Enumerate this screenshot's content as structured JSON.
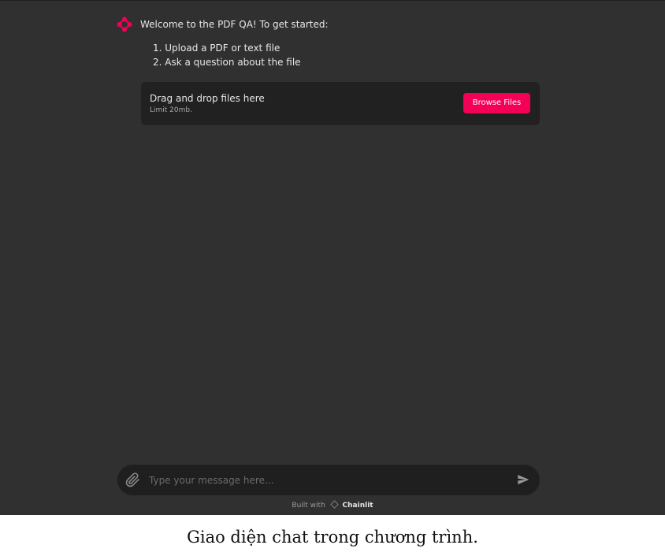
{
  "message": {
    "welcome": "Welcome to the PDF QA! To get started:",
    "steps": [
      "1. Upload a PDF or text file",
      "2. Ask a question about the file"
    ]
  },
  "upload": {
    "title": "Drag and drop files here",
    "limit": "Limit 20mb.",
    "button_label": "Browse Files"
  },
  "composer": {
    "placeholder": "Type your message here..."
  },
  "footer": {
    "built_with": "Built with",
    "brand": "Chainlit"
  },
  "caption": "Giao diện chat trong chương trình.",
  "colors": {
    "background": "#303030",
    "panel": "#212121",
    "accent": "#f50057"
  },
  "icons": {
    "avatar": "chainlit-logo-icon",
    "attach": "paperclip-icon",
    "send": "send-icon",
    "brand": "chainlit-mark-icon"
  }
}
